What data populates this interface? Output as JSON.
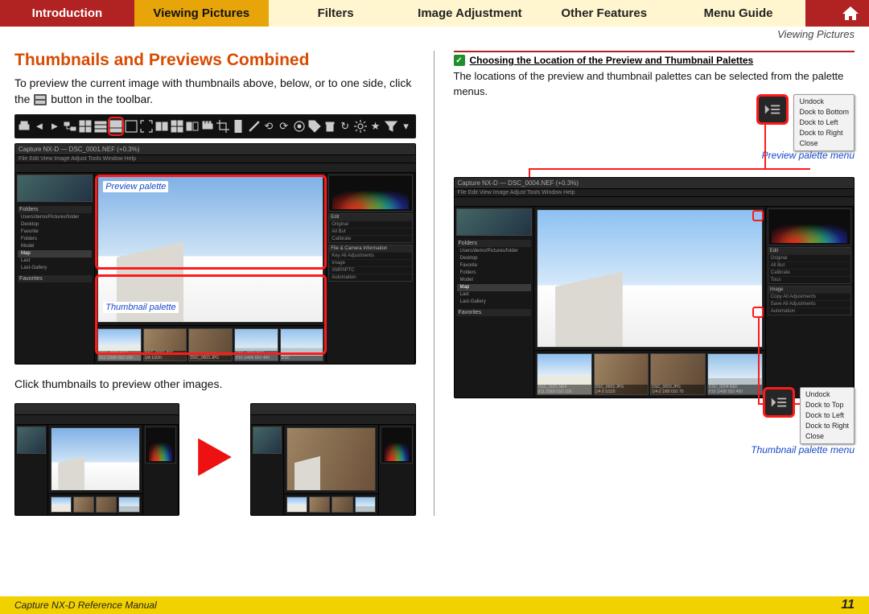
{
  "nav": {
    "items": [
      {
        "id": "introduction",
        "label": "Introduction"
      },
      {
        "id": "viewing-pictures",
        "label": "Viewing Pictures"
      },
      {
        "id": "filters",
        "label": "Filters"
      },
      {
        "id": "image-adjustment",
        "label": "Image Adjustment"
      },
      {
        "id": "other-features",
        "label": "Other Features"
      },
      {
        "id": "menu-guide",
        "label": "Menu Guide"
      }
    ],
    "active": "viewing-pictures",
    "home_icon": "home-icon"
  },
  "section_name": "Viewing Pictures",
  "left": {
    "title": "Thumbnails and Previews Combined",
    "p1a": "To preview the current image with thumbnails above, below, or to one side, click the ",
    "p1b": " button in the toolbar.",
    "p2": "Click thumbnails to preview other images.",
    "callout_preview": "Preview palette",
    "callout_thumbnail": "Thumbnail palette",
    "app_title": "Capture NX-D — DSC_0001.NEF (+0.3%)",
    "app_menus": "File  Edit  View  Image  Adjust  Tools  Window  Help",
    "folders_header": "Folders",
    "favorites_header": "Favorites",
    "folders": [
      "Users/demo/Pictures/folder",
      "Desktop",
      "Favorite",
      "Folders",
      "Model",
      "Map",
      "Last",
      "Last-Gallery"
    ],
    "thumbs": [
      {
        "name": "DSC_0001.NEF",
        "info": "f/11 1/500 ISO 100"
      },
      {
        "name": "DSC_0002.JPG",
        "info": "1/4 1/220"
      },
      {
        "name": "DSC_0003.JPG",
        "info": ""
      },
      {
        "name": "DSC_0004.NEF",
        "info": "f/10 1/400 ISO 400"
      },
      {
        "name": "DSC",
        "info": ""
      }
    ],
    "side_panels": [
      "Edit",
      "Original",
      "All But",
      "Calibrate",
      "File & Camera Information",
      "Key All Adjustments",
      "Image",
      "XMP/IPTC",
      "Automation"
    ]
  },
  "right": {
    "tip_title": "Choosing the Location of the Preview and Thumbnail Palettes",
    "tip_body": "The locations of the preview and thumbnail palettes can be selected from the palette menus.",
    "preview_menu_caption": "Preview palette menu",
    "thumb_menu_caption": "Thumbnail palette menu",
    "preview_menu_items": [
      "Undock",
      "Dock to Bottom",
      "Dock to Left",
      "Dock to Right",
      "Close"
    ],
    "thumb_menu_items": [
      "Undock",
      "Dock to Top",
      "Dock to Left",
      "Dock to Right",
      "Close"
    ],
    "app_title": "Capture NX-D — DSC_0004.NEF (+0.3%)",
    "thumbs": [
      {
        "name": "DSC_0001.NEF",
        "info": "f/11 1/500 ISO 100"
      },
      {
        "name": "DSC_0002.JPG",
        "info": "1/4 0 1/220"
      },
      {
        "name": "DSC_0003.JPG",
        "info": "1/4.0 1/80 ISO 70"
      },
      {
        "name": "DSC_0004.NEF",
        "info": "f/10 1/400 ISO 400"
      }
    ],
    "side_panels": [
      "Edit",
      "Original",
      "All But",
      "Calibrate",
      "Tous",
      "Image",
      "Copy All Adjustments",
      "Save All Adjustments",
      "Automation"
    ]
  },
  "footer": {
    "title": "Capture NX-D Reference Manual",
    "page": "11"
  }
}
